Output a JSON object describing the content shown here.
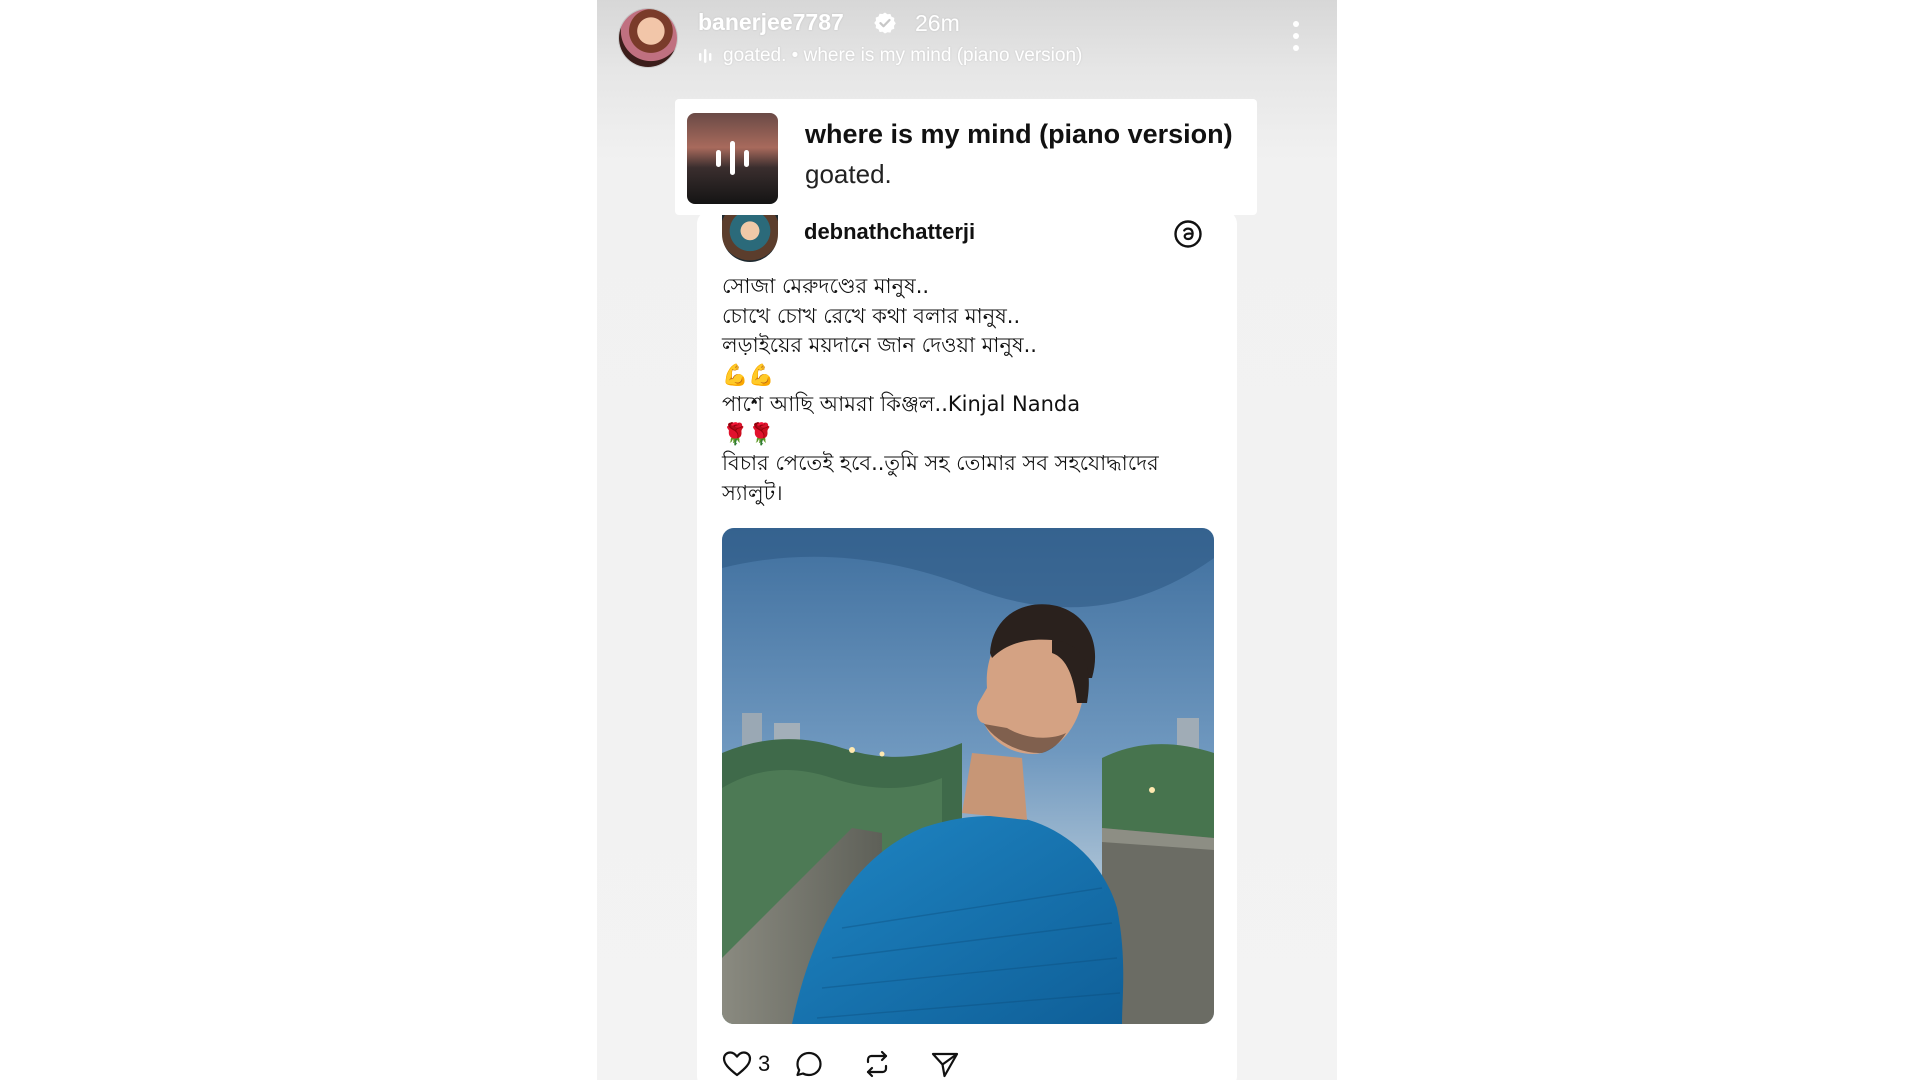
{
  "story": {
    "username": "banerjee7787",
    "time": "26m",
    "subline": "goated. • where is my mind (piano version)"
  },
  "music_sticker": {
    "title": "where is my mind (piano version)",
    "artist": "goated."
  },
  "post": {
    "username": "debnathchatterji",
    "text_lines": [
      "সোজা মেরুদণ্ডের মানুষ..",
      "চোখে চোখ রেখে কথা বলার মানুষ..",
      "লড়াইয়ের ময়দানে জান দেওয়া মানুষ..",
      "💪💪",
      "পাশে আছি আমরা কিঞ্জল..Kinjal Nanda",
      "🌹🌹",
      "বিচার পেতেই হবে..তুমি সহ তোমার সব সহযোদ্ধাদের",
      "স্যালুট।"
    ],
    "like_count": "3"
  },
  "icons": {
    "verified": "verified-badge-icon",
    "music": "music-bars-icon",
    "more": "more-vertical-icon",
    "threads": "threads-logo-icon",
    "like": "heart-icon",
    "comment": "comment-icon",
    "repost": "repost-icon",
    "share": "send-icon"
  },
  "colors": {
    "header_text": "#ffffff",
    "card_bg": "#ffffff",
    "text": "#111111"
  }
}
